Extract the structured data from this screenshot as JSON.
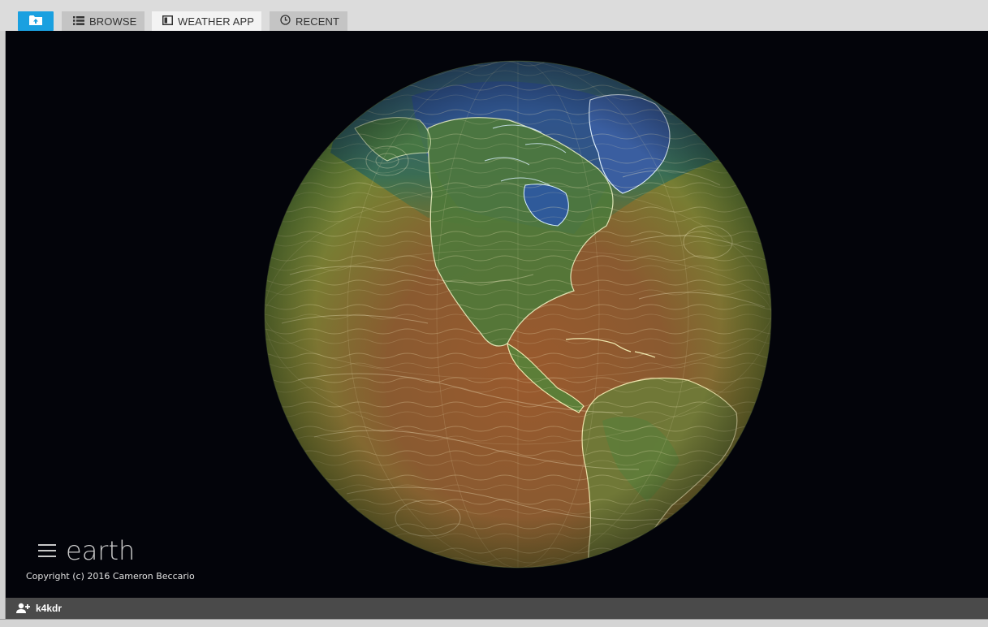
{
  "tabs": [
    {
      "id": "home",
      "label": "",
      "icon": "folder-up-icon",
      "active": false
    },
    {
      "id": "browse",
      "label": "BROWSE",
      "icon": "list-icon",
      "active": false
    },
    {
      "id": "weather",
      "label": "WEATHER APP",
      "icon": "window-icon",
      "active": true
    },
    {
      "id": "recent",
      "label": "RECENT",
      "icon": "clock-icon",
      "active": false
    }
  ],
  "app": {
    "menu_label": "earth",
    "copyright": "Copyright (c) 2016 Cameron Beccario"
  },
  "status": {
    "user": "k4kdr",
    "user_icon": "add-user-icon"
  },
  "colors": {
    "home_tab": "#1aa0e0",
    "viewport_bg": "#03040a",
    "status_bg": "#4a4a4a"
  }
}
